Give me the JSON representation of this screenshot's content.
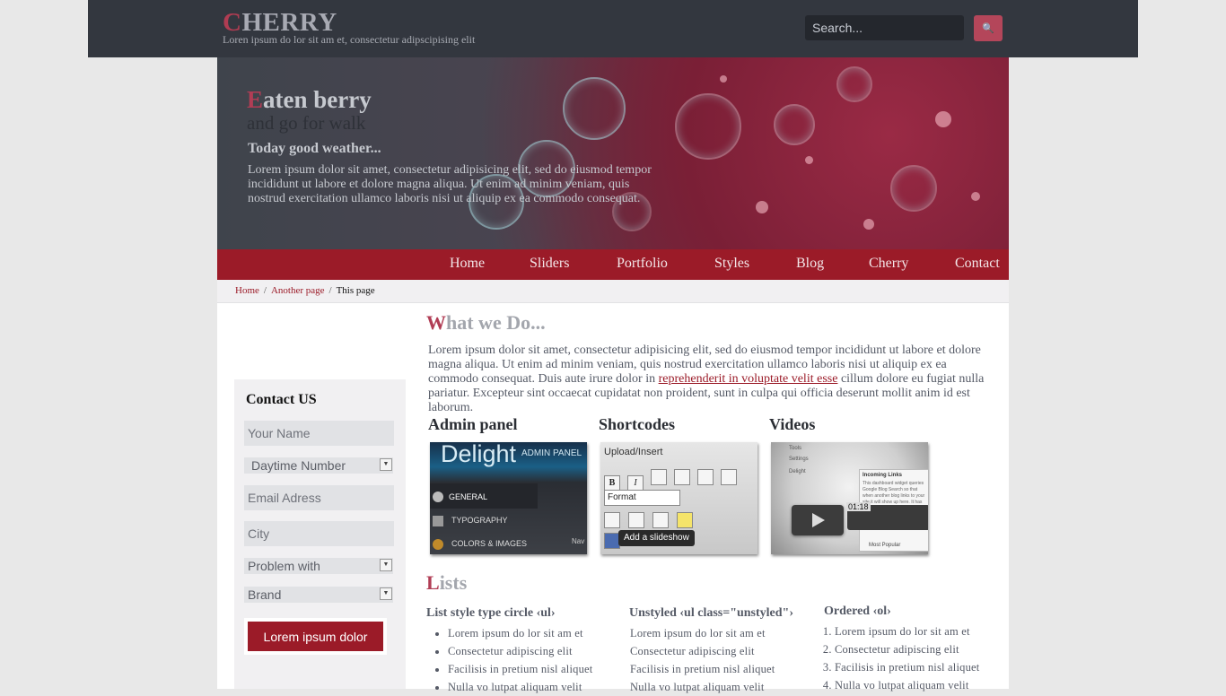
{
  "header": {
    "logo_first": "C",
    "logo_rest": "HERRY",
    "tagline": "Loren ipsum do lor sit am et, consectetur adipscipising elit",
    "search_placeholder": "Search...",
    "search_icon": "search-icon"
  },
  "hero": {
    "title_first": "E",
    "title_rest": "aten berry",
    "subtitle": "and go for walk",
    "heading": "Today good weather...",
    "paragraph": "Lorem ipsum dolor sit amet, consectetur adipisicing elit, sed do eiusmod tempor incididunt ut labore et dolore magna aliqua. Ut enim ad minim veniam, quis nostrud exercitation ullamco laboris nisi ut aliquip ex ea commodo consequat."
  },
  "nav": {
    "items": [
      "Home",
      "Sliders",
      "Portfolio",
      "Styles",
      "Blog",
      "Cherry",
      "Contact"
    ]
  },
  "breadcrumb": {
    "home": "Home",
    "another": "Another page",
    "sep": "/",
    "current": "This page"
  },
  "contact": {
    "title": "Contact US",
    "name_placeholder": "Your Name",
    "daytime": "Daytime Number",
    "email_placeholder": "Email Adress",
    "city_placeholder": "City",
    "problem": "Problem with",
    "brand": "Brand",
    "submit": "Lorem ipsum dolor"
  },
  "what": {
    "title_first": "W",
    "title_rest": "hat we Do...",
    "text_before": "Lorem ipsum dolor sit amet, consectetur adipisicing elit, sed do eiusmod tempor incididunt ut labore et dolore magna aliqua. Ut enim ad minim veniam, quis nostrud exercitation ullamco laboris nisi ut aliquip ex ea commodo consequat. Duis aute irure dolor in ",
    "link": "reprehenderit in voluptate velit esse",
    "text_after": " cillum dolore eu fugiat nulla pariatur. Excepteur sint occaecat cupidatat non proident, sunt in culpa qui officia deserunt mollit anim id est laborum."
  },
  "features": [
    {
      "title": "Admin panel",
      "thumb": {
        "brand": "Delight",
        "brand_sub": "ADMIN PANEL",
        "items": [
          "GENERAL",
          "TYPOGRAPHY",
          "COLORS & IMAGES"
        ],
        "corner": "Nav"
      }
    },
    {
      "title": "Shortcodes",
      "thumb": {
        "header": "Upload/Insert",
        "format": "Format",
        "tooltip": "Add a slideshow"
      }
    },
    {
      "title": "Videos",
      "thumb": {
        "side1": "Tools",
        "side2": "Settings",
        "side3": "Delight",
        "panel_title": "Incoming Links",
        "panel_text": "This dashboard widget queries Google Blog Search so that when another blog links to your site it will show up here. It has found no incoming links... yet.",
        "panel_foot": "Most Popular",
        "time": "01:18"
      }
    }
  ],
  "lists": {
    "title_first": "L",
    "title_rest": "ists",
    "circle": {
      "heading": "List style type circle ‹ul›",
      "items": [
        "Lorem ipsum do lor sit am et",
        "Consectetur adipiscing elit",
        "Facilisis in pretium nisl aliquet",
        "Nulla vo lutpat aliquam velit"
      ]
    },
    "unstyled": {
      "heading": "Unstyled ‹ul class=\"unstyled\"›",
      "items": [
        "Lorem ipsum do lor sit am et",
        "Consectetur adipiscing elit",
        "Facilisis in pretium nisl aliquet",
        "Nulla vo lutpat aliquam velit"
      ]
    },
    "ordered": {
      "heading": "Ordered ‹ol›",
      "items": [
        "Lorem ipsum do lor sit am et",
        "Consectetur adipiscing elit",
        "Facilisis in pretium nisl aliquet",
        "Nulla vo lutpat aliquam velit"
      ]
    }
  }
}
